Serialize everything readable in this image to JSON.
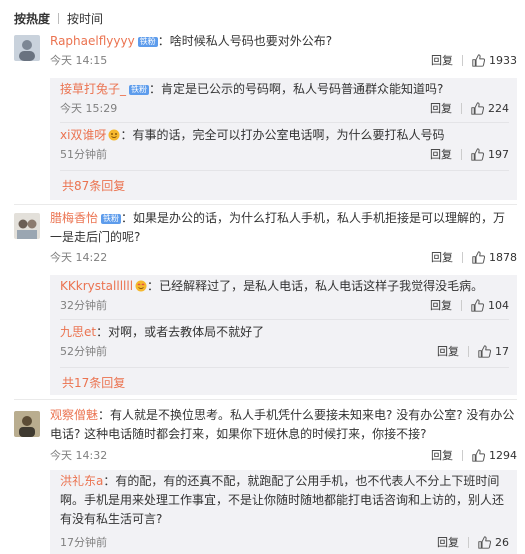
{
  "sort_tabs": {
    "hot": "按热度",
    "time": "按时间"
  },
  "labels": {
    "reply": "回复"
  },
  "colors": {
    "username": "#eb7350",
    "badge": "#5d9cec",
    "reply_panel": "#f2f2f5"
  },
  "comments": [
    {
      "user": "Raphaelflyyyy",
      "badge": "铁粉",
      "text": "啥时候私人号码也要对外公布?",
      "time": "今天 14:15",
      "likes": "1933",
      "replies": [
        {
          "user": "接草打兔子_",
          "badge": "铁粉",
          "text": "肯定是已公示的号码啊，私人号码普通群众能知道吗?",
          "time": "今天 15:29",
          "likes": "224"
        },
        {
          "user": "xi双谁呀",
          "text": "有事的话，完全可以打办公室电话啊，为什么要打私人号码",
          "time": "51分钟前",
          "likes": "197"
        }
      ],
      "more": "共87条回复"
    },
    {
      "user": "腊梅香怡",
      "badge": "铁粉",
      "text_line1": "如果是办公的话，为什么打私人手机，私人手机拒接是可以理解的，万",
      "text_line2": "一是走后门的呢?",
      "time": "今天 14:22",
      "likes": "1878",
      "replies": [
        {
          "user": "KKkrystallllll",
          "text": "已经解释过了，是私人电话，私人电话这样子我觉得没毛病。",
          "time": "32分钟前",
          "likes": "104"
        },
        {
          "user": "九思et",
          "text": "对啊，或者去教体局不就好了",
          "time": "52分钟前",
          "likes": "17"
        }
      ],
      "more": "共17条回复"
    },
    {
      "user": "观察僧魅",
      "text_line1": "有人就是不换位思考。私人手机凭什么要接未知来电? 没有办公室? 没有办公",
      "text_line2": "电话? 这种电话随时都会打来，如果你下班休息的时候打来，你接不接?",
      "time": "今天 14:32",
      "likes": "1294",
      "replies": [
        {
          "user": "洪礼东a",
          "text_line1": "有的配，有的还真不配，就跑配了公用手机，也不代表人不分上下班时间",
          "text_line2": "啊。手机是用来处理工作事宜，不是让你随时随地都能打电话咨询和上访的，别人还",
          "text_line3": "有没有私生活可言?",
          "time": "17分钟前",
          "likes": "26"
        }
      ]
    }
  ]
}
